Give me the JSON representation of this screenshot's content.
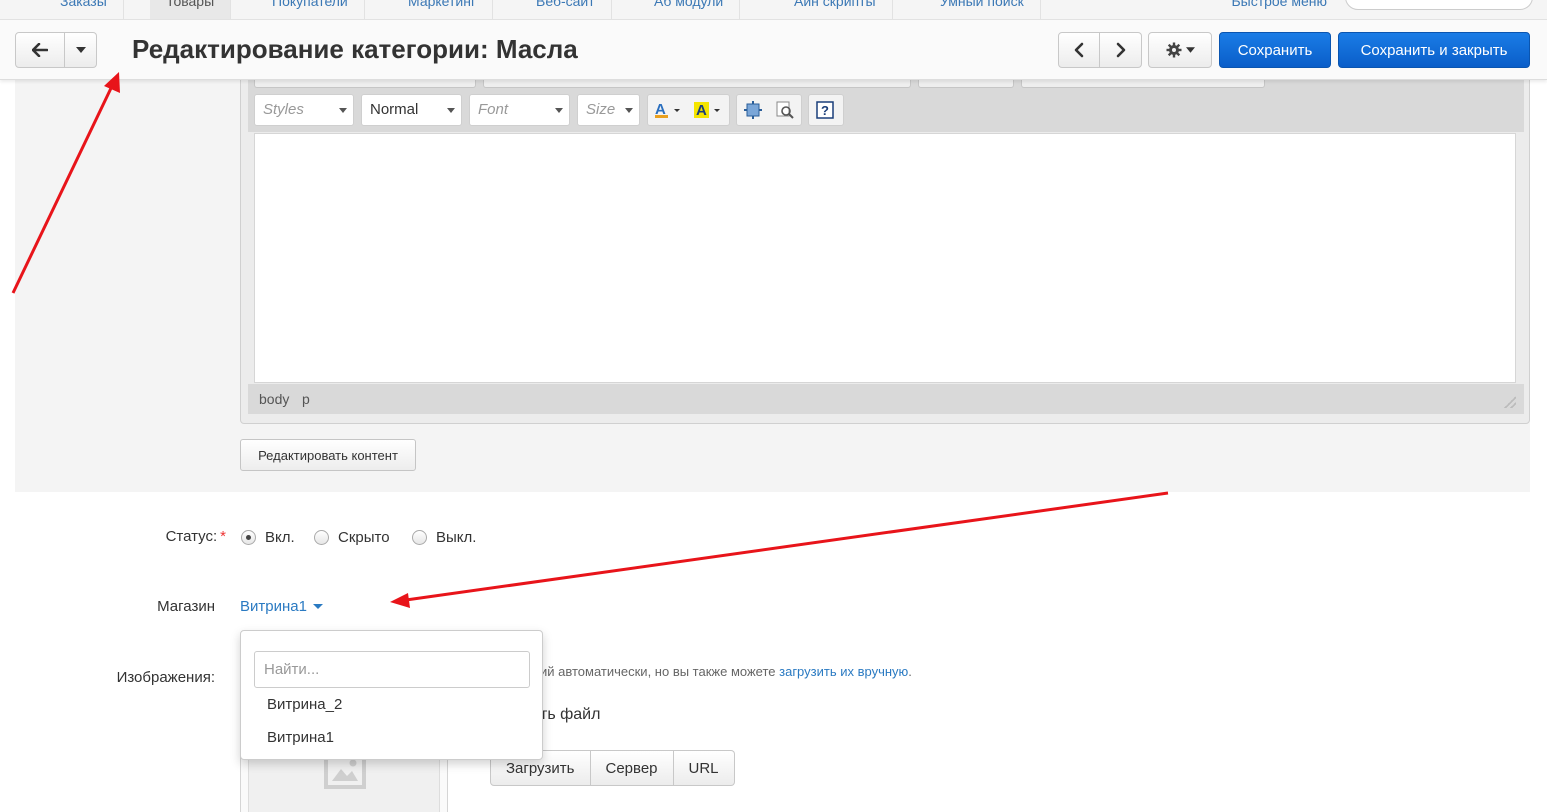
{
  "topnav": {
    "tabs": [
      "Заказы",
      "Товары",
      "Покупатели",
      "Маркетинг",
      "Веб-сайт",
      "Аб модули",
      "Аин скрипты",
      "Умный поиск"
    ],
    "quick_menu": "Быстрое меню"
  },
  "header": {
    "title": "Редактирование категории: Масла",
    "save_label": "Сохранить",
    "save_close_label": "Сохранить и закрыть"
  },
  "editor": {
    "styles_placeholder": "Styles",
    "format_value": "Normal",
    "font_placeholder": "Font",
    "size_placeholder": "Size",
    "path": [
      "body",
      "p"
    ],
    "edit_content_label": "Редактировать контент"
  },
  "form": {
    "status_label": "Статус:",
    "status_required_mark": "*",
    "status_options": [
      "Вкл.",
      "Скрыто",
      "Выкл."
    ],
    "status_selected": "Вкл.",
    "store_label": "Магазин",
    "store_value": "Витрина1",
    "images_label": "Изображения:",
    "images_hint": "ий автоматически, но вы также можете ",
    "images_hint_link": "загрузить их вручную",
    "images_hint_end": ".",
    "file_text": "ть файл",
    "upload_buttons": [
      "Загрузить",
      "Сервер",
      "URL"
    ]
  },
  "dropdown": {
    "search_placeholder": "Найти...",
    "options": [
      "Витрина_2",
      "Витрина1"
    ]
  },
  "colors": {
    "primary": "#0a5ec9",
    "link": "#2a7ac2",
    "annotation": "#e8141a"
  }
}
